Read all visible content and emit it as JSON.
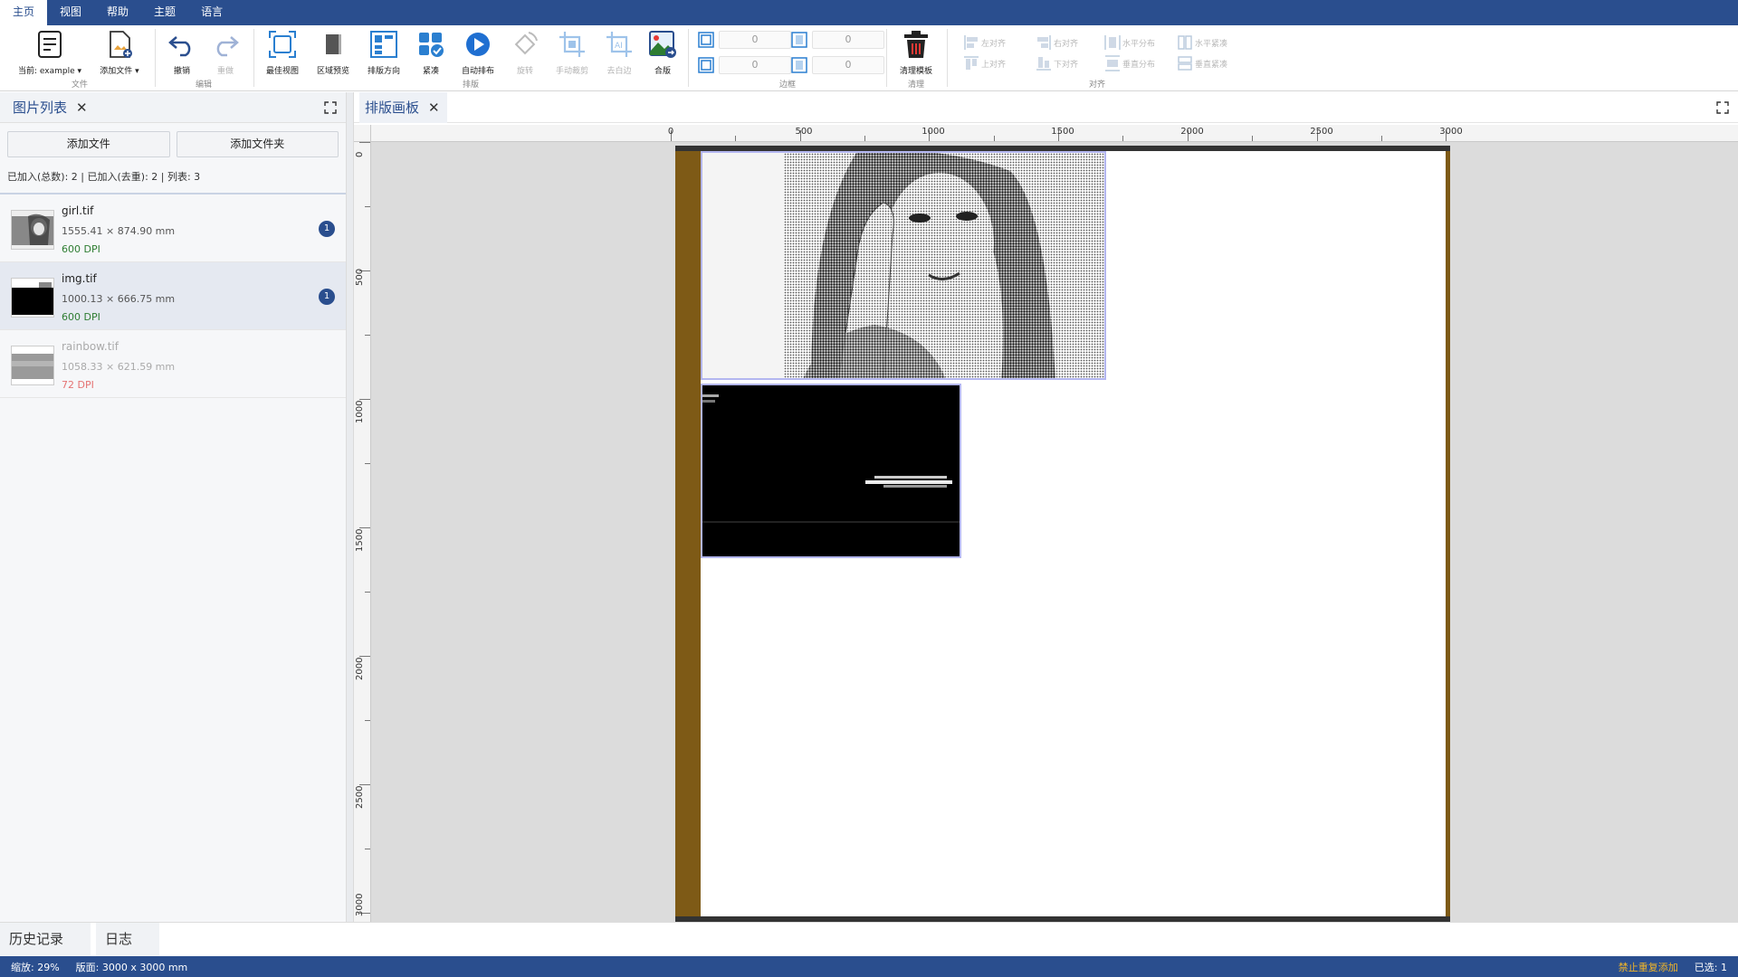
{
  "menu": {
    "tabs": [
      {
        "label": "主页",
        "active": true
      },
      {
        "label": "视图"
      },
      {
        "label": "帮助"
      },
      {
        "label": "主题"
      },
      {
        "label": "语言"
      }
    ]
  },
  "ribbon": {
    "file": {
      "current_label": "当前: example ▾",
      "add_file_label": "添加文件 ▾",
      "group_label": "文件"
    },
    "edit": {
      "undo_label": "撤销",
      "redo_label": "重做",
      "group_label": "编辑"
    },
    "layout": {
      "best_view": "最佳视图",
      "region_preview": "区域预览",
      "direction": "排版方向",
      "compact": "紧凑",
      "auto_arrange": "自动排布",
      "rotate": "旋转",
      "manual_crop": "手动裁剪",
      "trim_white": "去白边",
      "merge": "合版",
      "group_label": "排版"
    },
    "margins": {
      "top": "0",
      "right": "0",
      "bottom": "0",
      "left": "0",
      "group_label": "边框"
    },
    "clean": {
      "clean_template": "清理模板",
      "group_label": "清理"
    },
    "align": {
      "left": "左对齐",
      "right": "右对齐",
      "h_distribute": "水平分布",
      "h_compact": "水平紧凑",
      "top": "上对齐",
      "bottom": "下对齐",
      "v_distribute": "垂直分布",
      "v_compact": "垂直紧凑",
      "group_label": "对齐"
    }
  },
  "left_panel": {
    "title": "图片列表",
    "add_file": "添加文件",
    "add_folder": "添加文件夹",
    "stats": "已加入(总数): 2 | 已加入(去重): 2 | 列表: 3",
    "files": [
      {
        "name": "girl.tif",
        "size": "1555.41 × 874.90 mm",
        "dpi": "600 DPI",
        "count": "1"
      },
      {
        "name": "img.tif",
        "size": "1000.13 × 666.75 mm",
        "dpi": "600 DPI",
        "count": "1"
      },
      {
        "name": "rainbow.tif",
        "size": "1058.33 × 621.59 mm",
        "dpi": "72 DPI"
      }
    ]
  },
  "canvas": {
    "title": "排版画板",
    "ruler_h": [
      "0",
      "500",
      "1000",
      "1500",
      "2000",
      "2500",
      "3000"
    ],
    "ruler_v": [
      "0",
      "500",
      "1000",
      "1500",
      "2000",
      "2500",
      "3000"
    ]
  },
  "bottom_tabs": {
    "history": "历史记录",
    "log": "日志"
  },
  "status": {
    "zoom": "缩放: 29%",
    "sheet": "版面: 3000 x 3000 mm",
    "no_dup": "禁止重复添加",
    "selected": "已选: 1"
  },
  "colors": {
    "brand": "#2a4e8e",
    "sheet_bar": "#7e5a16",
    "selection": "#b3b6f0"
  }
}
